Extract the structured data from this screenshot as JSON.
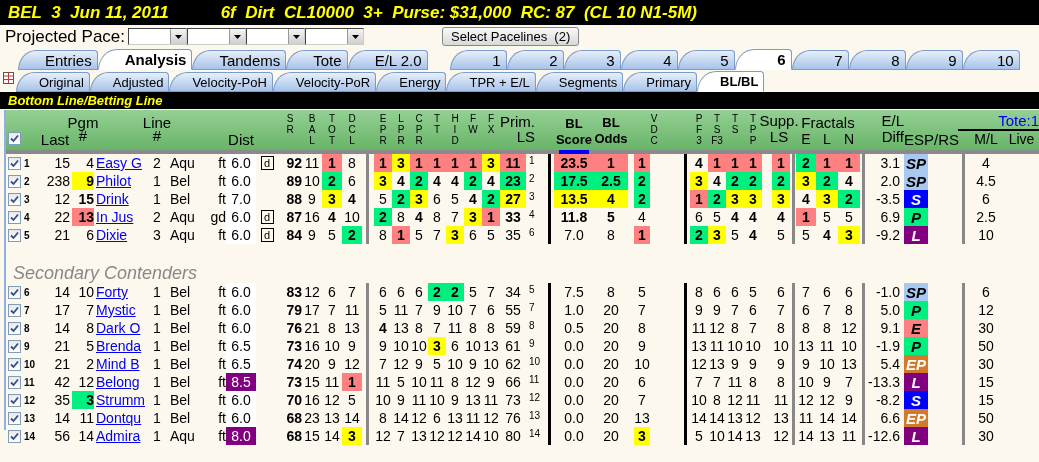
{
  "title_bar": {
    "race": "BEL  3  Jun 11, 2011",
    "conditions": "6f  Dirt  CL10000  3+  Purse: $31,000  RC: 87  (CL 10 N1-5M)"
  },
  "projected_pace": {
    "label": "Projected Pace:",
    "selects": [
      {
        "kind": "dropdown"
      },
      {
        "kind": "dropdown"
      },
      {
        "kind": "dropdown"
      },
      {
        "kind": "dropdown"
      }
    ],
    "button": "Select Pacelines  (2)"
  },
  "main_tabs": [
    {
      "label": "Entries",
      "selected": false
    },
    {
      "label": "Analysis",
      "selected": true
    },
    {
      "label": "Tandems",
      "selected": false
    },
    {
      "label": "Tote",
      "selected": false
    },
    {
      "label": "E/L 2.0",
      "selected": false
    }
  ],
  "race_tabs": [
    {
      "label": "1",
      "selected": false
    },
    {
      "label": "2",
      "selected": false
    },
    {
      "label": "3",
      "selected": false
    },
    {
      "label": "4",
      "selected": false
    },
    {
      "label": "5",
      "selected": false
    },
    {
      "label": "6",
      "selected": true
    },
    {
      "label": "7",
      "selected": false
    },
    {
      "label": "8",
      "selected": false
    },
    {
      "label": "9",
      "selected": false
    },
    {
      "label": "10",
      "selected": false
    }
  ],
  "view_tabs": [
    {
      "label": "Original",
      "selected": false
    },
    {
      "label": "Adjusted",
      "selected": false
    },
    {
      "label": "Velocity-PoH",
      "selected": false
    },
    {
      "label": "Velocity-PoR",
      "selected": false
    },
    {
      "label": "Energy",
      "selected": false
    },
    {
      "label": "TPR + E/L",
      "selected": false
    },
    {
      "label": "Segments",
      "selected": false
    },
    {
      "label": "Primary",
      "selected": false
    },
    {
      "label": "BL/BL",
      "selected": true
    }
  ],
  "section_title": "Bottom Line/Betting Line",
  "headings": {
    "select_all": {
      "checked": true
    },
    "last": "Last",
    "pgm": [
      "Pgm",
      "#"
    ],
    "line": [
      "Line",
      "#"
    ],
    "dist": "Dist",
    "sr": [
      "S",
      "R"
    ],
    "bal": [
      "B",
      "A",
      "L"
    ],
    "tot": [
      "T",
      "O",
      "T"
    ],
    "dcl": [
      "D",
      "C",
      "L"
    ],
    "pace": [
      [
        "E",
        "P",
        "R"
      ],
      [
        "L",
        "P",
        "R"
      ],
      [
        "C",
        "P",
        "R"
      ],
      [
        "T",
        "T"
      ],
      [
        "H",
        "I",
        "D"
      ],
      [
        "F",
        "W"
      ],
      [
        "F",
        "X"
      ]
    ],
    "prim_ls": [
      "Prim.",
      "LS"
    ],
    "bl_score": [
      "BL",
      "Score"
    ],
    "bl_odds": [
      "BL",
      "Odds"
    ],
    "vdc": [
      "V",
      "D",
      "C"
    ],
    "speed": [
      [
        "P",
        "F",
        "3"
      ],
      [
        "T",
        "S",
        "F3"
      ],
      [
        "T",
        "S"
      ],
      [
        "T",
        "P",
        "P"
      ]
    ],
    "supp_ls": [
      "Supp.",
      "LS"
    ],
    "fractals": {
      "title": "Fractals",
      "columns": [
        "E",
        "L",
        "N"
      ]
    },
    "el_diff": [
      "E/L",
      "Diff"
    ],
    "esp_rs": "ESP/RS",
    "tote": {
      "title": "Tote:1",
      "columns": [
        "M/L",
        "Live"
      ]
    }
  },
  "contenders": [
    {
      "checked": true,
      "number": "1",
      "last": "15",
      "pgm": {
        "text": "4",
        "bold": false
      },
      "name": "Easy G",
      "line": "2",
      "track": "Aqu",
      "surface": "ft",
      "dist": {
        "text": "6.0"
      },
      "marker": "d",
      "sr": "92",
      "bal": "11",
      "tot": {
        "text": "1",
        "bold": true,
        "color": "#ff8080"
      },
      "dcl": {
        "text": "8",
        "bold": false
      },
      "pace": [
        {
          "text": "1",
          "bold": true,
          "color": "#ff8080"
        },
        {
          "text": "3",
          "bold": true,
          "color": "#ffff00"
        },
        {
          "text": "1",
          "bold": true,
          "color": "#ff8080"
        },
        {
          "text": "1",
          "bold": true,
          "color": "#ff8080"
        },
        {
          "text": "1",
          "bold": true,
          "color": "#ff8080"
        },
        {
          "text": "1",
          "bold": true,
          "color": "#ff8080"
        },
        {
          "text": "3",
          "bold": true,
          "color": "#ffff00"
        }
      ],
      "prim_ls": {
        "text": "11",
        "bold": true,
        "color": "#ff8080"
      },
      "prim_rank": "1",
      "bl_score": {
        "text": "23.5",
        "bold": true,
        "color": "#ff8080"
      },
      "bl_odds": {
        "text": "1",
        "bold": true,
        "color": "#ff8080"
      },
      "vdc": {
        "text": "1",
        "bold": true,
        "color": "#ff8080"
      },
      "speed": [
        {
          "text": "4",
          "bold": true
        },
        {
          "text": "1",
          "bold": true,
          "color": "#ff8080"
        },
        {
          "text": "1",
          "bold": true,
          "color": "#ff8080"
        },
        {
          "text": "1",
          "bold": true,
          "color": "#ff8080"
        }
      ],
      "supp_ls": {
        "text": "1",
        "bold": true,
        "color": "#ff8080"
      },
      "fractals": [
        {
          "text": "2",
          "bold": true,
          "color": "#00f080"
        },
        {
          "text": "1",
          "bold": true,
          "color": "#ff8080"
        },
        {
          "text": "1",
          "bold": true,
          "color": "#ff8080"
        }
      ],
      "el_diff": "3.1",
      "esp_rs": {
        "text": "SP",
        "color": "#a8c8f0"
      },
      "ml": "4"
    },
    {
      "checked": true,
      "number": "2",
      "last": "238",
      "pgm": {
        "text": "9",
        "bold": true,
        "color": "#ffff00"
      },
      "name": "Philot",
      "line": "1",
      "track": "Bel",
      "surface": "ft",
      "dist": {
        "text": "6.0"
      },
      "sr": "89",
      "bal": "10",
      "tot": {
        "text": "2",
        "bold": true,
        "color": "#00f080"
      },
      "dcl": {
        "text": "6",
        "bold": false
      },
      "pace": [
        {
          "text": "3",
          "bold": true,
          "color": "#ffff00"
        },
        {
          "text": "4",
          "bold": true
        },
        {
          "text": "2",
          "bold": true,
          "color": "#00f080"
        },
        {
          "text": "4",
          "bold": true
        },
        {
          "text": "4",
          "bold": true
        },
        {
          "text": "2",
          "bold": true,
          "color": "#00f080"
        },
        {
          "text": "4",
          "bold": true
        }
      ],
      "prim_ls": {
        "text": "23",
        "bold": true,
        "color": "#00f080"
      },
      "prim_rank": "2",
      "bl_score": {
        "text": "17.5",
        "bold": true,
        "color": "#00f080"
      },
      "bl_odds": {
        "text": "2.5",
        "bold": true,
        "color": "#00f080"
      },
      "vdc": {
        "text": "2",
        "bold": true,
        "color": "#00f080"
      },
      "speed": [
        {
          "text": "3",
          "bold": true,
          "color": "#ffff00"
        },
        {
          "text": "4",
          "bold": true
        },
        {
          "text": "2",
          "bold": true,
          "color": "#00f080"
        },
        {
          "text": "2",
          "bold": true,
          "color": "#00f080"
        }
      ],
      "supp_ls": {
        "text": "2",
        "bold": true,
        "color": "#00f080"
      },
      "fractals": [
        {
          "text": "3",
          "bold": true,
          "color": "#ffff00"
        },
        {
          "text": "2",
          "bold": true,
          "color": "#00f080"
        },
        {
          "text": "4",
          "bold": true
        }
      ],
      "el_diff": "2.0",
      "esp_rs": {
        "text": "SP",
        "color": "#a8c8f0"
      },
      "ml": "4.5"
    },
    {
      "checked": true,
      "number": "3",
      "last": "12",
      "pgm": {
        "text": "15",
        "bold": true
      },
      "name": "Drink",
      "line": "1",
      "track": "Bel",
      "surface": "ft",
      "dist": {
        "text": "7.0"
      },
      "sr": "88",
      "bal": "9",
      "tot": {
        "text": "3",
        "bold": true,
        "color": "#ffff00"
      },
      "dcl": {
        "text": "4",
        "bold": true
      },
      "pace": [
        {
          "text": "5",
          "bold": false
        },
        {
          "text": "2",
          "bold": true,
          "color": "#00f080"
        },
        {
          "text": "3",
          "bold": true,
          "color": "#ffff00"
        },
        {
          "text": "6",
          "bold": false
        },
        {
          "text": "5",
          "bold": false
        },
        {
          "text": "4",
          "bold": true
        },
        {
          "text": "2",
          "bold": true,
          "color": "#00f080"
        }
      ],
      "prim_ls": {
        "text": "27",
        "bold": true,
        "color": "#ffff00"
      },
      "prim_rank": "3",
      "bl_score": {
        "text": "13.5",
        "bold": true,
        "color": "#ffff00"
      },
      "bl_odds": {
        "text": "4",
        "bold": true,
        "color": "#ffff00"
      },
      "vdc": {
        "text": "2",
        "bold": true,
        "color": "#00f080"
      },
      "speed": [
        {
          "text": "1",
          "bold": true,
          "color": "#ff8080"
        },
        {
          "text": "2",
          "bold": true,
          "color": "#00f080"
        },
        {
          "text": "3",
          "bold": true,
          "color": "#ffff00"
        },
        {
          "text": "3",
          "bold": true,
          "color": "#ffff00"
        }
      ],
      "supp_ls": {
        "text": "3",
        "bold": true,
        "color": "#ffff00"
      },
      "fractals": [
        {
          "text": "4",
          "bold": true
        },
        {
          "text": "3",
          "bold": true,
          "color": "#ffff00"
        },
        {
          "text": "2",
          "bold": true,
          "color": "#00f080"
        }
      ],
      "el_diff": "-3.5",
      "esp_rs": {
        "text": "S",
        "color": "#0000ff"
      },
      "ml": "6"
    },
    {
      "checked": true,
      "number": "4",
      "last": "22",
      "pgm": {
        "text": "13",
        "bold": true,
        "color": "#ff8080"
      },
      "name": "In Jus",
      "line": "2",
      "track": "Aqu",
      "surface": "gd",
      "dist": {
        "text": "6.0"
      },
      "marker": "d",
      "sr": "87",
      "bal": "16",
      "tot": {
        "text": "4",
        "bold": true
      },
      "dcl": {
        "text": "10",
        "bold": false
      },
      "pace": [
        {
          "text": "2",
          "bold": true,
          "color": "#00f080"
        },
        {
          "text": "8",
          "bold": false
        },
        {
          "text": "4",
          "bold": true
        },
        {
          "text": "8",
          "bold": false
        },
        {
          "text": "7",
          "bold": false
        },
        {
          "text": "3",
          "bold": true,
          "color": "#ffff00"
        },
        {
          "text": "1",
          "bold": true,
          "color": "#ff8080"
        }
      ],
      "prim_ls": {
        "text": "33",
        "bold": true
      },
      "prim_rank": "4",
      "bl_score": {
        "text": "11.8",
        "bold": true
      },
      "bl_odds": {
        "text": "5",
        "bold": true
      },
      "vdc": {
        "text": "4",
        "bold": false
      },
      "speed": [
        {
          "text": "6",
          "bold": false
        },
        {
          "text": "5",
          "bold": false
        },
        {
          "text": "4",
          "bold": true
        },
        {
          "text": "4",
          "bold": true
        }
      ],
      "supp_ls": {
        "text": "4",
        "bold": true
      },
      "fractals": [
        {
          "text": "1",
          "bold": true,
          "color": "#ff8080"
        },
        {
          "text": "5",
          "bold": false
        },
        {
          "text": "5",
          "bold": false
        }
      ],
      "el_diff": "6.9",
      "esp_rs": {
        "text": "P",
        "color": "#00f080"
      },
      "ml": "2.5"
    },
    {
      "checked": true,
      "number": "5",
      "last": "21",
      "pgm": {
        "text": "6",
        "bold": false
      },
      "name": "Dixie",
      "line": "3",
      "track": "Aqu",
      "surface": "ft",
      "dist": {
        "text": "6.0"
      },
      "marker": "d",
      "sr": "84",
      "bal": "9",
      "tot": {
        "text": "5",
        "bold": false
      },
      "dcl": {
        "text": "2",
        "bold": true,
        "color": "#00f080"
      },
      "pace": [
        {
          "text": "8",
          "bold": false
        },
        {
          "text": "1",
          "bold": true,
          "color": "#ff8080"
        },
        {
          "text": "5",
          "bold": false
        },
        {
          "text": "7",
          "bold": false
        },
        {
          "text": "3",
          "bold": true,
          "color": "#ffff00"
        },
        {
          "text": "6",
          "bold": false
        },
        {
          "text": "5",
          "bold": false
        }
      ],
      "prim_ls": {
        "text": "35",
        "bold": false
      },
      "prim_rank": "6",
      "bl_score": {
        "text": "7.0",
        "bold": false
      },
      "bl_odds": {
        "text": "8",
        "bold": false
      },
      "vdc": {
        "text": "1",
        "bold": true,
        "color": "#ff8080"
      },
      "speed": [
        {
          "text": "2",
          "bold": true,
          "color": "#00f080"
        },
        {
          "text": "3",
          "bold": true,
          "color": "#ffff00"
        },
        {
          "text": "5",
          "bold": false
        },
        {
          "text": "4",
          "bold": true
        }
      ],
      "supp_ls": {
        "text": "5",
        "bold": false
      },
      "fractals": [
        {
          "text": "5",
          "bold": false
        },
        {
          "text": "4",
          "bold": true
        },
        {
          "text": "3",
          "bold": true,
          "color": "#ffff00"
        }
      ],
      "el_diff": "-9.2",
      "esp_rs": {
        "text": "L",
        "color": "#800080"
      },
      "ml": "10"
    }
  ],
  "secondary": {
    "title": "Secondary Contenders",
    "rows": [
      {
        "checked": true,
        "number": "6",
        "last": "14",
        "pgm": {
          "text": "10",
          "bold": false
        },
        "name": "Forty",
        "line": "1",
        "track": "Bel",
        "surface": "ft",
        "dist": {
          "text": "6.0"
        },
        "sr": "83",
        "bal": "12",
        "tot": {
          "text": "6",
          "bold": false
        },
        "dcl": {
          "text": "7",
          "bold": false
        },
        "pace": [
          {
            "text": "6",
            "bold": false
          },
          {
            "text": "6",
            "bold": false
          },
          {
            "text": "6",
            "bold": false
          },
          {
            "text": "2",
            "bold": true,
            "color": "#00f080"
          },
          {
            "text": "2",
            "bold": true,
            "color": "#00f080"
          },
          {
            "text": "5",
            "bold": false
          },
          {
            "text": "7",
            "bold": false
          }
        ],
        "prim_ls": {
          "text": "34",
          "bold": false
        },
        "prim_rank": "5",
        "bl_score": {
          "text": "7.5",
          "bold": false
        },
        "bl_odds": {
          "text": "8",
          "bold": false
        },
        "vdc": {
          "text": "5",
          "bold": false
        },
        "speed": [
          {
            "text": "8",
            "bold": false
          },
          {
            "text": "6",
            "bold": false
          },
          {
            "text": "6",
            "bold": false
          },
          {
            "text": "5",
            "bold": false
          }
        ],
        "supp_ls": {
          "text": "6",
          "bold": false
        },
        "fractals": [
          {
            "text": "7",
            "bold": false
          },
          {
            "text": "6",
            "bold": false
          },
          {
            "text": "6",
            "bold": false
          }
        ],
        "el_diff": "-1.0",
        "esp_rs": {
          "text": "SP",
          "color": "#a8c8f0"
        },
        "ml": "6"
      },
      {
        "checked": true,
        "number": "7",
        "last": "17",
        "pgm": {
          "text": "7",
          "bold": false
        },
        "name": "Mystic",
        "line": "1",
        "track": "Bel",
        "surface": "ft",
        "dist": {
          "text": "6.0"
        },
        "sr": "79",
        "bal": "17",
        "tot": {
          "text": "7",
          "bold": false
        },
        "dcl": {
          "text": "11",
          "bold": false
        },
        "pace": [
          {
            "text": "5",
            "bold": false
          },
          {
            "text": "11",
            "bold": false
          },
          {
            "text": "7",
            "bold": false
          },
          {
            "text": "9",
            "bold": false
          },
          {
            "text": "10",
            "bold": false
          },
          {
            "text": "7",
            "bold": false
          },
          {
            "text": "6",
            "bold": false
          }
        ],
        "prim_ls": {
          "text": "55",
          "bold": false
        },
        "prim_rank": "7",
        "bl_score": {
          "text": "1.0",
          "bold": false
        },
        "bl_odds": {
          "text": "20",
          "bold": false
        },
        "vdc": {
          "text": "7",
          "bold": false
        },
        "speed": [
          {
            "text": "9",
            "bold": false
          },
          {
            "text": "9",
            "bold": false
          },
          {
            "text": "7",
            "bold": false
          },
          {
            "text": "6",
            "bold": false
          }
        ],
        "supp_ls": {
          "text": "7",
          "bold": false
        },
        "fractals": [
          {
            "text": "6",
            "bold": false
          },
          {
            "text": "7",
            "bold": false
          },
          {
            "text": "8",
            "bold": false
          }
        ],
        "el_diff": "5.0",
        "esp_rs": {
          "text": "P",
          "color": "#00f080"
        },
        "ml": "12"
      },
      {
        "checked": true,
        "number": "8",
        "last": "14",
        "pgm": {
          "text": "8",
          "bold": false
        },
        "name": "Dark O",
        "line": "1",
        "track": "Bel",
        "surface": "ft",
        "dist": {
          "text": "6.0"
        },
        "sr": "76",
        "bal": "21",
        "tot": {
          "text": "8",
          "bold": false
        },
        "dcl": {
          "text": "13",
          "bold": false
        },
        "pace": [
          {
            "text": "4",
            "bold": true
          },
          {
            "text": "13",
            "bold": false
          },
          {
            "text": "8",
            "bold": false
          },
          {
            "text": "7",
            "bold": false
          },
          {
            "text": "11",
            "bold": false
          },
          {
            "text": "8",
            "bold": false
          },
          {
            "text": "8",
            "bold": false
          }
        ],
        "prim_ls": {
          "text": "59",
          "bold": false
        },
        "prim_rank": "8",
        "bl_score": {
          "text": "0.5",
          "bold": false
        },
        "bl_odds": {
          "text": "20",
          "bold": false
        },
        "vdc": {
          "text": "8",
          "bold": false
        },
        "speed": [
          {
            "text": "11",
            "bold": false
          },
          {
            "text": "12",
            "bold": false
          },
          {
            "text": "8",
            "bold": false
          },
          {
            "text": "7",
            "bold": false
          }
        ],
        "supp_ls": {
          "text": "8",
          "bold": false
        },
        "fractals": [
          {
            "text": "8",
            "bold": false
          },
          {
            "text": "8",
            "bold": false
          },
          {
            "text": "12",
            "bold": false
          }
        ],
        "el_diff": "9.1",
        "esp_rs": {
          "text": "E",
          "color": "#ff8080"
        },
        "ml": "30"
      },
      {
        "checked": true,
        "number": "9",
        "last": "21",
        "pgm": {
          "text": "5",
          "bold": false
        },
        "name": "Brenda",
        "line": "1",
        "track": "Bel",
        "surface": "ft",
        "dist": {
          "text": "6.5"
        },
        "sr": "73",
        "bal": "16",
        "tot": {
          "text": "10",
          "bold": false
        },
        "dcl": {
          "text": "9",
          "bold": false
        },
        "pace": [
          {
            "text": "9",
            "bold": false
          },
          {
            "text": "10",
            "bold": false
          },
          {
            "text": "10",
            "bold": false
          },
          {
            "text": "3",
            "bold": true,
            "color": "#ffff00"
          },
          {
            "text": "6",
            "bold": false
          },
          {
            "text": "10",
            "bold": false
          },
          {
            "text": "13",
            "bold": false
          }
        ],
        "prim_ls": {
          "text": "61",
          "bold": false
        },
        "prim_rank": "9",
        "bl_score": {
          "text": "0.0",
          "bold": false
        },
        "bl_odds": {
          "text": "20",
          "bold": false
        },
        "vdc": {
          "text": "9",
          "bold": false
        },
        "speed": [
          {
            "text": "13",
            "bold": false
          },
          {
            "text": "11",
            "bold": false
          },
          {
            "text": "10",
            "bold": false
          },
          {
            "text": "10",
            "bold": false
          }
        ],
        "supp_ls": {
          "text": "10",
          "bold": false
        },
        "fractals": [
          {
            "text": "13",
            "bold": false
          },
          {
            "text": "11",
            "bold": false
          },
          {
            "text": "10",
            "bold": false
          }
        ],
        "el_diff": "-1.9",
        "esp_rs": {
          "text": "P",
          "color": "#00f080"
        },
        "ml": "50"
      },
      {
        "checked": true,
        "number": "10",
        "last": "21",
        "pgm": {
          "text": "2",
          "bold": false
        },
        "name": "Mind B",
        "line": "1",
        "track": "Bel",
        "surface": "ft",
        "dist": {
          "text": "6.5"
        },
        "sr": "74",
        "bal": "20",
        "tot": {
          "text": "9",
          "bold": false
        },
        "dcl": {
          "text": "12",
          "bold": false
        },
        "pace": [
          {
            "text": "7",
            "bold": false
          },
          {
            "text": "12",
            "bold": false
          },
          {
            "text": "9",
            "bold": false
          },
          {
            "text": "5",
            "bold": false
          },
          {
            "text": "10",
            "bold": false
          },
          {
            "text": "9",
            "bold": false
          },
          {
            "text": "10",
            "bold": false
          }
        ],
        "prim_ls": {
          "text": "62",
          "bold": false
        },
        "prim_rank": "10",
        "bl_score": {
          "text": "0.0",
          "bold": false
        },
        "bl_odds": {
          "text": "20",
          "bold": false
        },
        "vdc": {
          "text": "10",
          "bold": false
        },
        "speed": [
          {
            "text": "12",
            "bold": false
          },
          {
            "text": "13",
            "bold": false
          },
          {
            "text": "9",
            "bold": false
          },
          {
            "text": "9",
            "bold": false
          }
        ],
        "supp_ls": {
          "text": "9",
          "bold": false
        },
        "fractals": [
          {
            "text": "9",
            "bold": false
          },
          {
            "text": "10",
            "bold": false
          },
          {
            "text": "13",
            "bold": false
          }
        ],
        "el_diff": "5.4",
        "esp_rs": {
          "text": "EP",
          "color": "#d4782a"
        },
        "ml": "30"
      },
      {
        "checked": true,
        "number": "11",
        "last": "42",
        "pgm": {
          "text": "12",
          "bold": false
        },
        "name": "Belong",
        "line": "1",
        "track": "Bel",
        "surface": "ft",
        "dist": {
          "text": "8.5",
          "color": "#800080"
        },
        "sr": "73",
        "bal": "15",
        "tot": {
          "text": "11",
          "bold": false
        },
        "dcl": {
          "text": "1",
          "bold": true,
          "color": "#ff8080"
        },
        "pace": [
          {
            "text": "11",
            "bold": false
          },
          {
            "text": "5",
            "bold": false
          },
          {
            "text": "10",
            "bold": false
          },
          {
            "text": "11",
            "bold": false
          },
          {
            "text": "8",
            "bold": false
          },
          {
            "text": "12",
            "bold": false
          },
          {
            "text": "9",
            "bold": false
          }
        ],
        "prim_ls": {
          "text": "66",
          "bold": false
        },
        "prim_rank": "11",
        "bl_score": {
          "text": "0.0",
          "bold": false
        },
        "bl_odds": {
          "text": "20",
          "bold": false
        },
        "vdc": {
          "text": "6",
          "bold": false
        },
        "speed": [
          {
            "text": "7",
            "bold": false
          },
          {
            "text": "7",
            "bold": false
          },
          {
            "text": "11",
            "bold": false
          },
          {
            "text": "8",
            "bold": false
          }
        ],
        "supp_ls": {
          "text": "8",
          "bold": false
        },
        "fractals": [
          {
            "text": "10",
            "bold": false
          },
          {
            "text": "9",
            "bold": false
          },
          {
            "text": "7",
            "bold": false
          }
        ],
        "el_diff": "-13.3",
        "esp_rs": {
          "text": "L",
          "color": "#800080"
        },
        "ml": "15"
      },
      {
        "checked": true,
        "number": "12",
        "last": "35",
        "pgm": {
          "text": "3",
          "bold": true,
          "color": "#00f080"
        },
        "name": "Strumm",
        "line": "1",
        "track": "Bel",
        "surface": "ft",
        "dist": {
          "text": "6.0"
        },
        "sr": "70",
        "bal": "16",
        "tot": {
          "text": "12",
          "bold": false
        },
        "dcl": {
          "text": "5",
          "bold": false
        },
        "pace": [
          {
            "text": "10",
            "bold": false
          },
          {
            "text": "9",
            "bold": false
          },
          {
            "text": "11",
            "bold": false
          },
          {
            "text": "10",
            "bold": false
          },
          {
            "text": "9",
            "bold": false
          },
          {
            "text": "13",
            "bold": false
          },
          {
            "text": "11",
            "bold": false
          }
        ],
        "prim_ls": {
          "text": "73",
          "bold": false
        },
        "prim_rank": "12",
        "bl_score": {
          "text": "0.0",
          "bold": false
        },
        "bl_odds": {
          "text": "20",
          "bold": false
        },
        "vdc": {
          "text": "7",
          "bold": false
        },
        "speed": [
          {
            "text": "10",
            "bold": false
          },
          {
            "text": "8",
            "bold": false
          },
          {
            "text": "12",
            "bold": false
          },
          {
            "text": "11",
            "bold": false
          }
        ],
        "supp_ls": {
          "text": "11",
          "bold": false
        },
        "fractals": [
          {
            "text": "12",
            "bold": false
          },
          {
            "text": "12",
            "bold": false
          },
          {
            "text": "9",
            "bold": false
          }
        ],
        "el_diff": "-8.2",
        "esp_rs": {
          "text": "S",
          "color": "#0000ff"
        },
        "ml": "15"
      },
      {
        "checked": true,
        "number": "13",
        "last": "14",
        "pgm": {
          "text": "11",
          "bold": false
        },
        "name": "Dontqu",
        "line": "1",
        "track": "Bel",
        "surface": "ft",
        "dist": {
          "text": "6.0"
        },
        "sr": "68",
        "bal": "23",
        "tot": {
          "text": "13",
          "bold": false
        },
        "dcl": {
          "text": "14",
          "bold": false
        },
        "pace": [
          {
            "text": "8",
            "bold": false
          },
          {
            "text": "14",
            "bold": false
          },
          {
            "text": "12",
            "bold": false
          },
          {
            "text": "6",
            "bold": false
          },
          {
            "text": "13",
            "bold": false
          },
          {
            "text": "11",
            "bold": false
          },
          {
            "text": "12",
            "bold": false
          }
        ],
        "prim_ls": {
          "text": "76",
          "bold": false
        },
        "prim_rank": "13",
        "bl_score": {
          "text": "0.0",
          "bold": false
        },
        "bl_odds": {
          "text": "20",
          "bold": false
        },
        "vdc": {
          "text": "13",
          "bold": false
        },
        "speed": [
          {
            "text": "14",
            "bold": false
          },
          {
            "text": "14",
            "bold": false
          },
          {
            "text": "13",
            "bold": false
          },
          {
            "text": "12",
            "bold": false
          }
        ],
        "supp_ls": {
          "text": "13",
          "bold": false
        },
        "fractals": [
          {
            "text": "11",
            "bold": false
          },
          {
            "text": "14",
            "bold": false
          },
          {
            "text": "14",
            "bold": false
          }
        ],
        "el_diff": "6.6",
        "esp_rs": {
          "text": "EP",
          "color": "#d4782a"
        },
        "ml": "50"
      },
      {
        "checked": true,
        "number": "14",
        "last": "56",
        "pgm": {
          "text": "14",
          "bold": false
        },
        "name": "Admira",
        "line": "1",
        "track": "Aqu",
        "surface": "ft",
        "dist": {
          "text": "8.0",
          "color": "#800080"
        },
        "sr": "68",
        "bal": "15",
        "tot": {
          "text": "14",
          "bold": false
        },
        "dcl": {
          "text": "3",
          "bold": true,
          "color": "#ffff00"
        },
        "pace": [
          {
            "text": "12",
            "bold": false
          },
          {
            "text": "7",
            "bold": false
          },
          {
            "text": "13",
            "bold": false
          },
          {
            "text": "12",
            "bold": false
          },
          {
            "text": "12",
            "bold": false
          },
          {
            "text": "14",
            "bold": false
          },
          {
            "text": "10",
            "bold": false
          }
        ],
        "prim_ls": {
          "text": "80",
          "bold": false
        },
        "prim_rank": "14",
        "bl_score": {
          "text": "0.0",
          "bold": false
        },
        "bl_odds": {
          "text": "20",
          "bold": false
        },
        "vdc": {
          "text": "3",
          "bold": true,
          "color": "#ffff00"
        },
        "speed": [
          {
            "text": "5",
            "bold": false
          },
          {
            "text": "10",
            "bold": false
          },
          {
            "text": "14",
            "bold": false
          },
          {
            "text": "13",
            "bold": false
          }
        ],
        "supp_ls": {
          "text": "12",
          "bold": false
        },
        "fractals": [
          {
            "text": "14",
            "bold": false
          },
          {
            "text": "13",
            "bold": false
          },
          {
            "text": "11",
            "bold": false
          }
        ],
        "el_diff": "-12.6",
        "esp_rs": {
          "text": "L",
          "color": "#800080"
        },
        "ml": "30"
      }
    ]
  }
}
